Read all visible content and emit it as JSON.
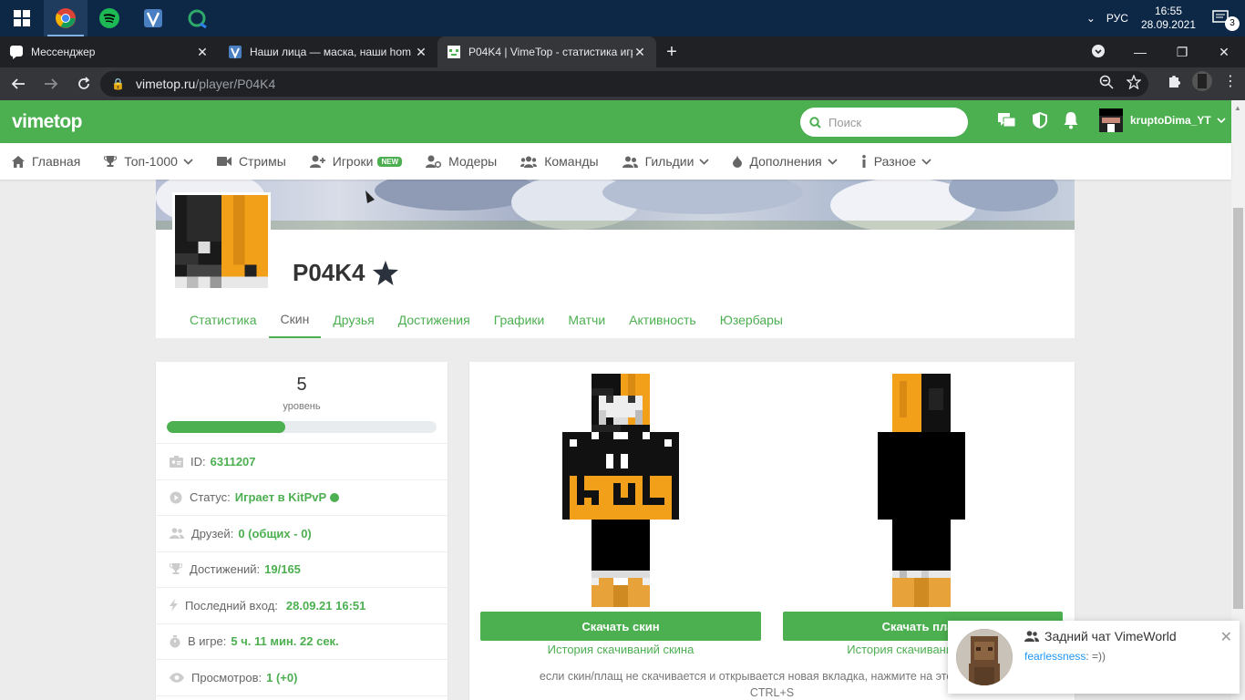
{
  "taskbar": {
    "lang": "РУС",
    "time": "16:55",
    "date": "28.09.2021",
    "notif_count": "3"
  },
  "tabs": [
    {
      "title": "Мессенджер"
    },
    {
      "title": "Наши лица — маска, наши hom"
    },
    {
      "title": "P04K4 | VimeTop - статистика игр"
    }
  ],
  "address": {
    "host": "vimetop.ru",
    "path": "/player/P04K4"
  },
  "header": {
    "logo": "vimetop",
    "search_placeholder": "Поиск",
    "username": "kruptoDima_YT"
  },
  "nav": {
    "home": "Главная",
    "top": "Топ-1000",
    "streams": "Стримы",
    "players": "Игроки",
    "new_badge": "NEW",
    "moders": "Модеры",
    "teams": "Команды",
    "guilds": "Гильдии",
    "addons": "Дополнения",
    "misc": "Разное"
  },
  "profile": {
    "name": "P04K4",
    "tabs": [
      "Статистика",
      "Скин",
      "Друзья",
      "Достижения",
      "Графики",
      "Матчи",
      "Активность",
      "Юзербары"
    ]
  },
  "stats": {
    "level": "5",
    "level_label": "уровень",
    "level_progress": 0.44,
    "id_label": "ID:",
    "id": "6311207",
    "status_label": "Статус:",
    "status": "Играет в KitPvP",
    "friends_label": "Друзей:",
    "friends": "0 (общих - 0)",
    "achievements_label": "Достижений:",
    "achievements": "19/165",
    "last_login_label": "Последний вход:",
    "last_login": "28.09.21 16:51",
    "ingame_label": "В игре:",
    "ingame": "5 ч. 11 мин. 22 сек.",
    "views_label": "Просмотров:",
    "views": "1 (+0)"
  },
  "skin": {
    "download_skin": "Скачать скин",
    "download_cape": "Скачать плащ",
    "skin_history": "История скачиваний скина",
    "cape_history": "История скачиваний плаща",
    "note": "если скин/плащ не скачивается и открывается новая вкладка, нажмите на этой вкладке",
    "note2": "CTRL+S"
  },
  "chat": {
    "title": "Задний чат VimeWorld",
    "author": "fearlessness",
    "message": ": =))"
  }
}
